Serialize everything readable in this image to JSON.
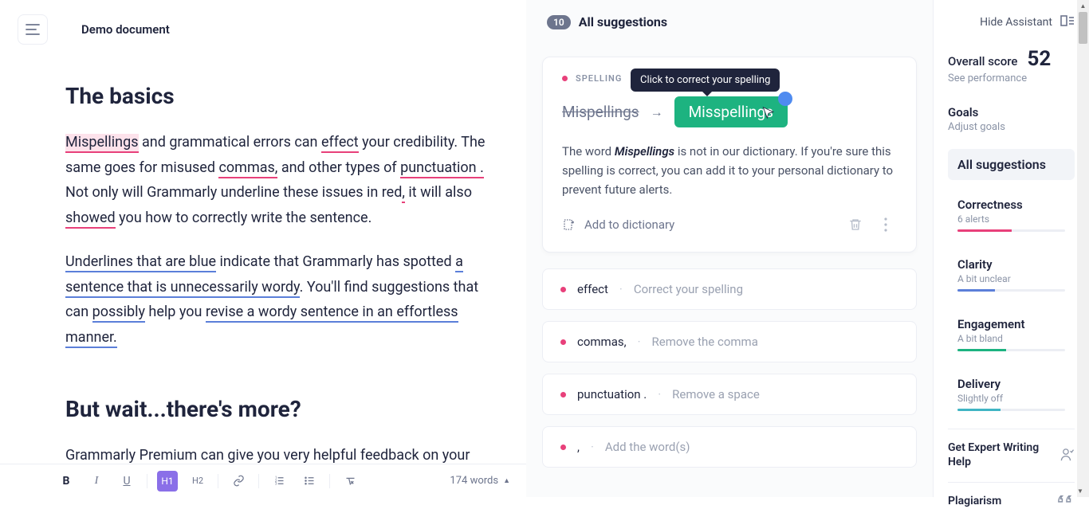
{
  "header": {
    "doc_title": "Demo document"
  },
  "document": {
    "h1": "The basics",
    "p1_mispellings": "Mispellings",
    "p1_a": " and grammatical errors can ",
    "p1_effect": "effect",
    "p1_b": " your credibility. The same goes for misused ",
    "p1_commas": "commas,",
    "p1_c": " and other types of ",
    "p1_punct": "punctuation .",
    "p1_d": " Not only will Grammarly underline these issues in red",
    "p1_comma2": ",",
    "p1_e": " it will also ",
    "p1_showed": "showed",
    "p1_f": " you how to correctly write the sentence.",
    "p2_a": "Underlines that are blue",
    "p2_b": " indicate that Grammarly has spotted ",
    "p2_c": "a sentence that is unnecessarily wordy",
    "p2_d": ". You'll find suggestions that can ",
    "p2_e": "possibly",
    "p2_f": " help you ",
    "p2_g": "revise a wordy sentence in an effortless manner",
    "p2_h": ".",
    "h2": "But wait...there's more?",
    "p3": "Grammarly Premium can give you very helpful feedback on your"
  },
  "toolbar": {
    "bold": "B",
    "italic": "I",
    "underline": "U",
    "h1": "H1",
    "h2": "H2",
    "word_count": "174 words"
  },
  "suggestions": {
    "count": "10",
    "title": "All suggestions",
    "tooltip": "Click to correct your spelling",
    "active": {
      "category": "SPELLING",
      "wrong": "Mispellings",
      "arrow": "→",
      "correct": "Misspellings",
      "desc_a": "The word ",
      "desc_word": "Mispellings",
      "desc_b": " is not in our dictionary. If you're sure this spelling is correct, you can add it to your personal dictionary to prevent future alerts.",
      "add_dict": "Add to dictionary"
    },
    "list": [
      {
        "word": "effect",
        "hint": "Correct your spelling"
      },
      {
        "word": "commas,",
        "hint": "Remove the comma"
      },
      {
        "word": "punctuation .",
        "hint": "Remove a space"
      },
      {
        "word": ",",
        "hint": "Add the word(s)"
      }
    ]
  },
  "sidebar": {
    "hide": "Hide Assistant",
    "score_label": "Overall score",
    "score": "52",
    "see_perf": "See performance",
    "goals_title": "Goals",
    "goals_sub": "Adjust goals",
    "filters": {
      "all": "All suggestions",
      "correctness": {
        "title": "Correctness",
        "sub": "6 alerts"
      },
      "clarity": {
        "title": "Clarity",
        "sub": "A bit unclear"
      },
      "engagement": {
        "title": "Engagement",
        "sub": "A bit bland"
      },
      "delivery": {
        "title": "Delivery",
        "sub": "Slightly off"
      }
    },
    "expert": "Get Expert Writing Help",
    "plagiarism": "Plagiarism"
  }
}
